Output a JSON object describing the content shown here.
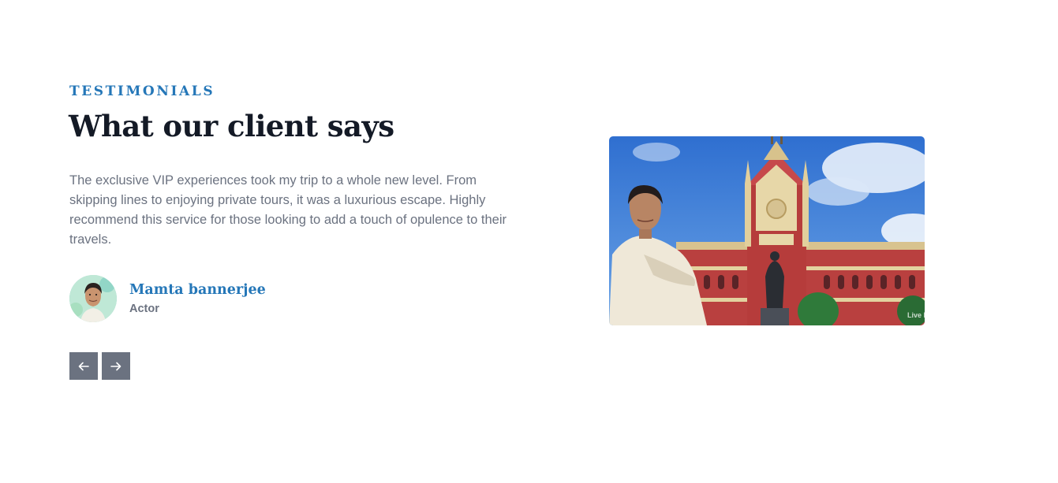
{
  "testimonials": {
    "eyebrow": "TESTIMONIALS",
    "title": "What our client says",
    "quote": "The exclusive VIP experiences took my trip to a whole new level. From skipping lines to enjoying private tours, it was a luxurious escape. Highly recommend this service for those looking to add a touch of opulence to their travels.",
    "author": {
      "name": "Mamta bannerjee",
      "role": "Actor",
      "avatar_icon": "avatar-photo"
    },
    "navigation": {
      "prev_icon": "arrow-left-icon",
      "next_icon": "arrow-right-icon"
    },
    "image": {
      "icon": "testimonial-photo",
      "watermark": "Live Law"
    }
  },
  "colors": {
    "accent": "#2577b8",
    "heading": "#141a26",
    "body_text": "#6b7280",
    "nav_button": "#6b7280",
    "background": "#ffffff"
  }
}
